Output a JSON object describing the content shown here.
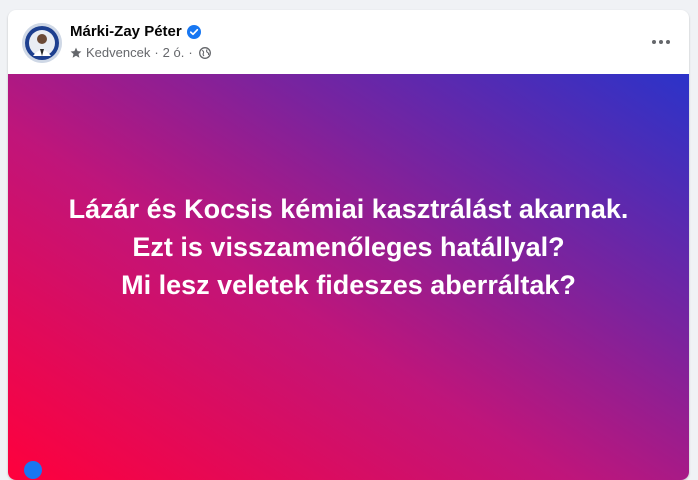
{
  "post": {
    "author": "Márki-Zay Péter",
    "verified_icon": "verified-badge-icon",
    "meta": {
      "audience_label": "Kedvencek",
      "separator": "·",
      "time": "2 ó.",
      "separator2": "·",
      "privacy_icon": "globe-icon"
    },
    "more_icon": "more-options-icon",
    "text_lines": [
      "Lázár és Kocsis kémiai kasztrálást akarnak.",
      "Ezt is visszamenőleges hatállyal?",
      "Mi lesz veletek fideszes aberráltak?"
    ]
  },
  "colors": {
    "accent": "#1877f2",
    "gradient": [
      "#ff003c",
      "#c0157a",
      "#7a239e",
      "#2b33c9"
    ],
    "text_on_banner": "#ffffff",
    "meta_text": "#65676b"
  }
}
